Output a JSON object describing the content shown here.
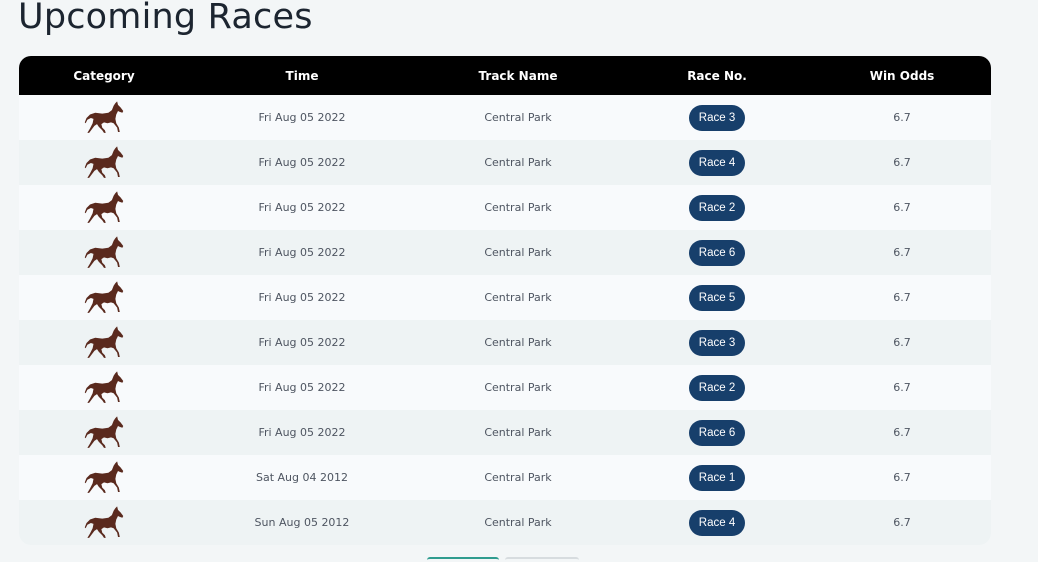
{
  "page": {
    "title": "Upcoming Races"
  },
  "table": {
    "columns": [
      "Category",
      "Time",
      "Track Name",
      "Race No.",
      "Win Odds"
    ],
    "rows": [
      {
        "category_icon": "horse-icon",
        "time": "Fri Aug 05 2022",
        "track": "Central Park",
        "race": "Race 3",
        "odds": "6.7"
      },
      {
        "category_icon": "horse-icon",
        "time": "Fri Aug 05 2022",
        "track": "Central Park",
        "race": "Race 4",
        "odds": "6.7"
      },
      {
        "category_icon": "horse-icon",
        "time": "Fri Aug 05 2022",
        "track": "Central Park",
        "race": "Race 2",
        "odds": "6.7"
      },
      {
        "category_icon": "horse-icon",
        "time": "Fri Aug 05 2022",
        "track": "Central Park",
        "race": "Race 6",
        "odds": "6.7"
      },
      {
        "category_icon": "horse-icon",
        "time": "Fri Aug 05 2022",
        "track": "Central Park",
        "race": "Race 5",
        "odds": "6.7"
      },
      {
        "category_icon": "horse-icon",
        "time": "Fri Aug 05 2022",
        "track": "Central Park",
        "race": "Race 3",
        "odds": "6.7"
      },
      {
        "category_icon": "horse-icon",
        "time": "Fri Aug 05 2022",
        "track": "Central Park",
        "race": "Race 2",
        "odds": "6.7"
      },
      {
        "category_icon": "horse-icon",
        "time": "Fri Aug 05 2022",
        "track": "Central Park",
        "race": "Race 6",
        "odds": "6.7"
      },
      {
        "category_icon": "horse-icon",
        "time": "Sat Aug 04 2012",
        "track": "Central Park",
        "race": "Race 1",
        "odds": "6.7"
      },
      {
        "category_icon": "horse-icon",
        "time": "Sun Aug 05 2012",
        "track": "Central Park",
        "race": "Race 4",
        "odds": "6.7"
      }
    ]
  },
  "colors": {
    "header_bg": "#000000",
    "race_pill": "#173f6b",
    "track_link": "#2f8e83",
    "horse": "#5a2a1e"
  }
}
